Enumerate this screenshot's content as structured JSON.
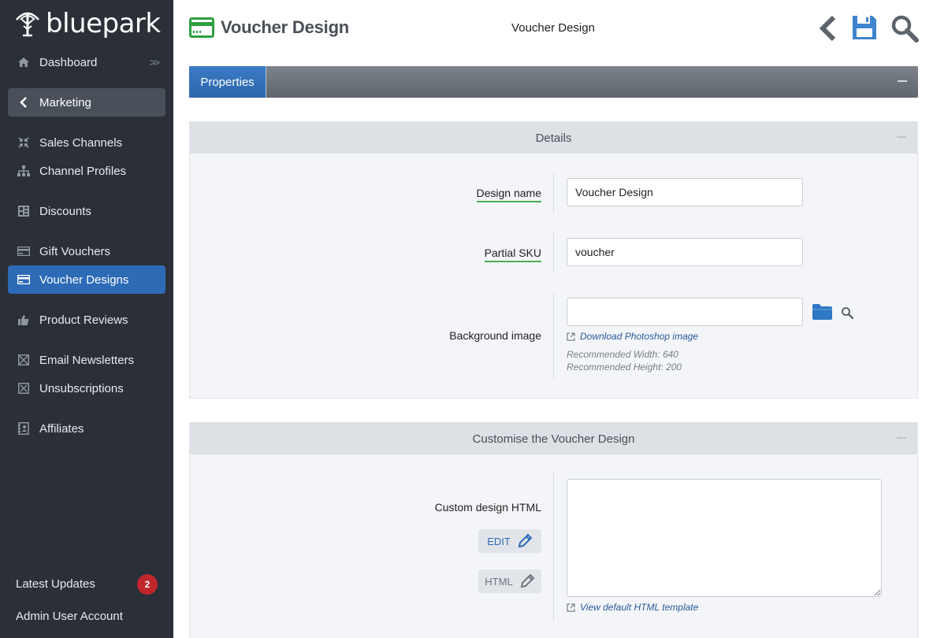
{
  "app": {
    "logo_text": "bluepark"
  },
  "sidebar": {
    "items": [
      {
        "label": "Dashboard",
        "icon": "home-icon"
      },
      {
        "label": "Marketing",
        "icon": "chevron-left-icon"
      },
      {
        "label": "Sales Channels",
        "icon": "compress-icon"
      },
      {
        "label": "Channel Profiles",
        "icon": "sitemap-icon"
      },
      {
        "label": "Discounts",
        "icon": "discount-grid-icon"
      },
      {
        "label": "Gift Vouchers",
        "icon": "card-icon"
      },
      {
        "label": "Voucher Designs",
        "icon": "card-icon"
      },
      {
        "label": "Product Reviews",
        "icon": "thumbs-up-icon"
      },
      {
        "label": "Email Newsletters",
        "icon": "envelope-x-icon"
      },
      {
        "label": "Unsubscriptions",
        "icon": "envelope-x-icon"
      },
      {
        "label": "Affiliates",
        "icon": "address-book-icon"
      }
    ],
    "latest_updates": "Latest Updates",
    "latest_updates_count": "2",
    "admin_account": "Admin User Account"
  },
  "header": {
    "title": "Voucher Design",
    "center_title": "Voucher Design",
    "icons": [
      "back-icon",
      "save-icon",
      "search-icon"
    ]
  },
  "tabs": {
    "properties": "Properties"
  },
  "details": {
    "heading": "Details",
    "design_name_label": "Design name",
    "design_name_value": "Voucher Design",
    "partial_sku_label": "Partial SKU",
    "partial_sku_value": "voucher",
    "background_image_label": "Background image",
    "background_image_value": "",
    "download_link": "Download Photoshop image",
    "recommended_width": "Recommended Width: 640",
    "recommended_height": "Recommended Height: 200"
  },
  "customise": {
    "heading": "Customise the Voucher Design",
    "custom_html_label": "Custom design HTML",
    "edit_button": "EDIT",
    "html_button": "HTML",
    "view_template_link": "View default HTML template"
  },
  "colors": {
    "sidebar_bg": "#2b3038",
    "active_blue": "#2d6bb7",
    "required_underline": "#4caf50",
    "badge_red": "#c0272d",
    "brand_green": "#2e9e3e"
  }
}
